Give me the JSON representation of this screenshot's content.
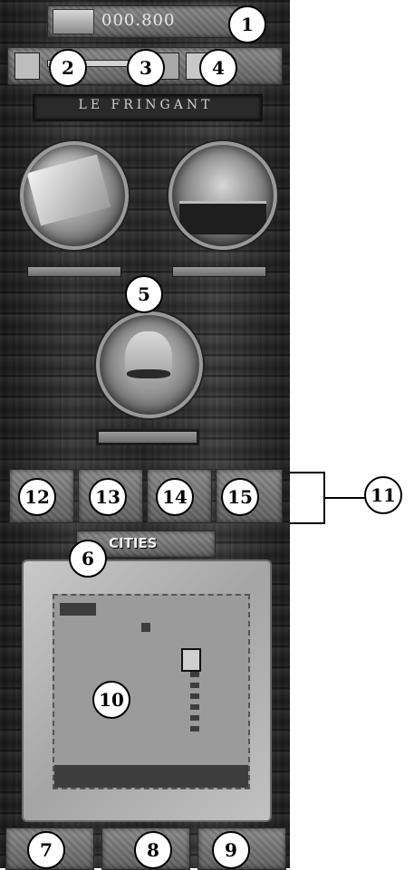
{
  "header": {
    "money": "000.800"
  },
  "ship": {
    "name": "LE FRINGANT"
  },
  "cities_tab": {
    "label": "CITIES"
  },
  "callouts": {
    "c1": "1",
    "c2": "2",
    "c3": "3",
    "c4": "4",
    "c5": "5",
    "c6": "6",
    "c7": "7",
    "c8": "8",
    "c9": "9",
    "c10": "10",
    "c11": "11",
    "c12": "12",
    "c13": "13",
    "c14": "14",
    "c15": "15"
  },
  "colors": {
    "map_sea": "#9b9b9b",
    "map_land": "#3d3d3d",
    "parchment": "#bdbdbd"
  }
}
